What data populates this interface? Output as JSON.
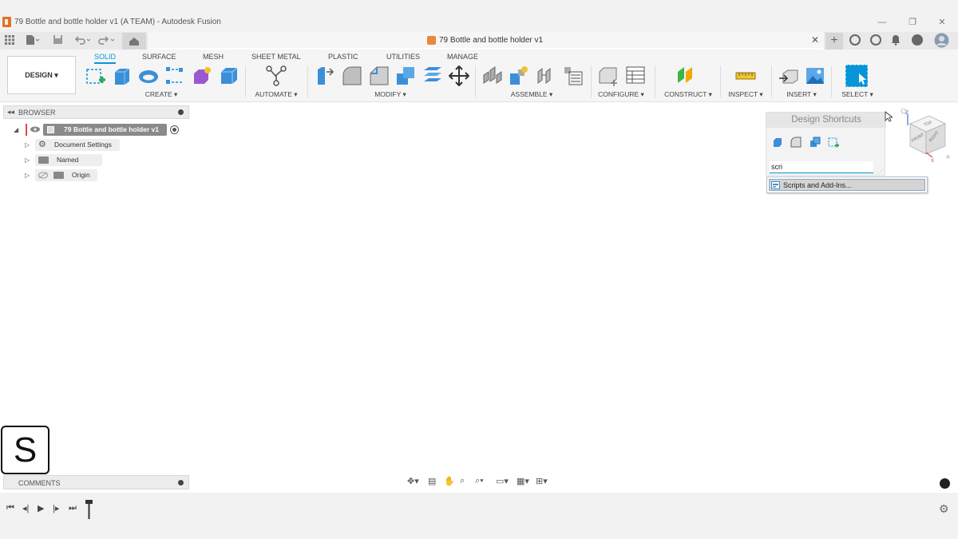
{
  "window": {
    "title": "79 Bottle and bottle holder v1 (A TEAM) - Autodesk Fusion",
    "minimize": "—",
    "restore": "❐",
    "close": "✕"
  },
  "tabbar": {
    "doc_title": "79 Bottle and bottle holder v1",
    "close_glyph": "✕",
    "plus_glyph": "+"
  },
  "toolbar": {
    "design_label": "DESIGN",
    "workspace_tabs": [
      "SOLID",
      "SURFACE",
      "MESH",
      "SHEET METAL",
      "PLASTIC",
      "UTILITIES",
      "MANAGE"
    ],
    "active_tab": "SOLID",
    "groups": [
      "CREATE",
      "AUTOMATE",
      "MODIFY",
      "ASSEMBLE",
      "CONFIGURE",
      "CONSTRUCT",
      "INSPECT",
      "INSERT",
      "SELECT"
    ],
    "accent": "#0696d7"
  },
  "browser": {
    "title": "BROWSER",
    "root": "79 Bottle and bottle holder v1",
    "items": [
      "Document Settings",
      "Named Views",
      "Origin"
    ]
  },
  "shortcuts": {
    "title": "Design Shortcuts",
    "search_value": "scri",
    "suggestion": "Scripts and Add-Ins..."
  },
  "viewcube": {
    "top": "TOP",
    "front": "FRONT",
    "right": "RIGHT",
    "z": "Z",
    "x": "X"
  },
  "badge": {
    "letter": "S"
  },
  "comments": {
    "title": "COMMENTS"
  },
  "icons": [
    "grid-menu-icon",
    "file-icon",
    "save-icon",
    "undo-icon",
    "redo-icon",
    "home-icon",
    "gear-icon"
  ]
}
